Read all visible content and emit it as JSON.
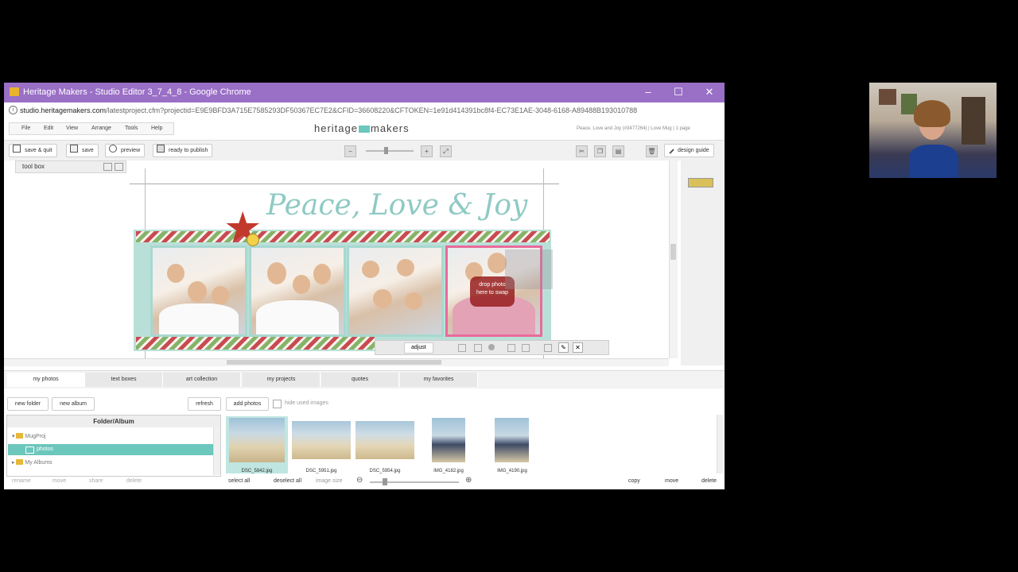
{
  "window": {
    "title": "Heritage Makers - Studio Editor 3_7_4_8 - Google Chrome",
    "controls": [
      "–",
      "☐",
      "✕"
    ]
  },
  "browser": {
    "url_host": "studio.heritagemakers.com",
    "url_path": "/latestproject.cfm?projectid=E9E9BFD3A715E7585293DF50367EC7E2&CFID=36608220&CFTOKEN=1e91d414391bc8f4-EC73E1AE-3048-6168-A89488B193010788"
  },
  "menu": [
    "File",
    "Edit",
    "View",
    "Arrange",
    "Tools",
    "Help"
  ],
  "brand": {
    "left": "heritage",
    "right": "makers",
    "accent": "#6cc7bd"
  },
  "project_info": "Peace, Love and Joy (#3477264) | Love Mug | 1 page",
  "toolbar": {
    "save_quit": "save & quit",
    "save": "save",
    "preview": "preview",
    "ready": "ready to publish",
    "design_guide": "design guide"
  },
  "canvas": {
    "toolbox_label": "tool box",
    "title_text": "Peace, Love & Joy",
    "drop_hint_1": "drop photo",
    "drop_hint_2": "here to swap",
    "adjust_label": "adjust"
  },
  "tabs": [
    "my photos",
    "text boxes",
    "art collection",
    "my projects",
    "quotes",
    "my favorites"
  ],
  "photo_panel": {
    "new_folder": "new folder",
    "new_album": "new album",
    "refresh": "refresh",
    "add_photos": "add photos",
    "hide_used": "hide used images",
    "folder_header": "Folder/Album",
    "tree": [
      "MugProj",
      "photos",
      "My Albums"
    ],
    "thumbnails": [
      "DSC_5842.jpg",
      "DSC_5951.jpg",
      "DSC_5954.jpg",
      "IMG_4182.jpg",
      "IMG_4190.jpg"
    ],
    "folder_actions": [
      "rename",
      "move",
      "share",
      "delete"
    ],
    "select_all": "select all",
    "deselect_all": "deselect all",
    "image_size": "image size",
    "copy": "copy",
    "move": "move",
    "delete": "delete"
  }
}
